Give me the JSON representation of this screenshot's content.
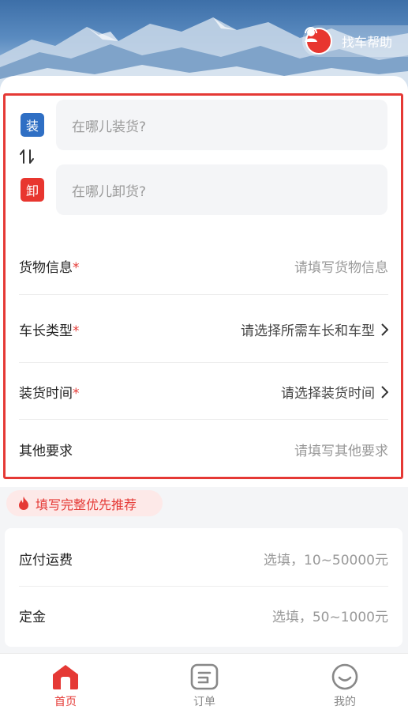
{
  "header": {
    "help_label": "找车帮助"
  },
  "address": {
    "load_badge": "装",
    "unload_badge": "卸",
    "load_placeholder": "在哪儿装货?",
    "unload_placeholder": "在哪儿卸货?",
    "load_badge_color": "#2f6fc4",
    "unload_badge_color": "#e8362f"
  },
  "form": {
    "rows": [
      {
        "label": "货物信息",
        "required": "*",
        "value": "请填写货物信息"
      },
      {
        "label": "车长类型",
        "required": "*",
        "value": "请选择所需车长和车型"
      },
      {
        "label": "装货时间",
        "required": "*",
        "value": "请选择装货时间"
      },
      {
        "label": "其他要求",
        "required": "",
        "value": "请填写其他要求"
      }
    ]
  },
  "tip": {
    "text": "填写完整优先推荐",
    "icon": "flame-icon"
  },
  "fees": {
    "rows": [
      {
        "label": "应付运费",
        "value": "选填，10~50000元"
      },
      {
        "label": "定金",
        "value": "选填，50~1000元"
      }
    ]
  },
  "tabbar": {
    "tabs": [
      {
        "label": "首页",
        "icon": "home-icon",
        "active": true
      },
      {
        "label": "订单",
        "icon": "order-icon",
        "active": false
      },
      {
        "label": "我的",
        "icon": "smile-icon",
        "active": false
      }
    ]
  },
  "colors": {
    "accent": "#e53935",
    "blue": "#2f6fc4"
  }
}
